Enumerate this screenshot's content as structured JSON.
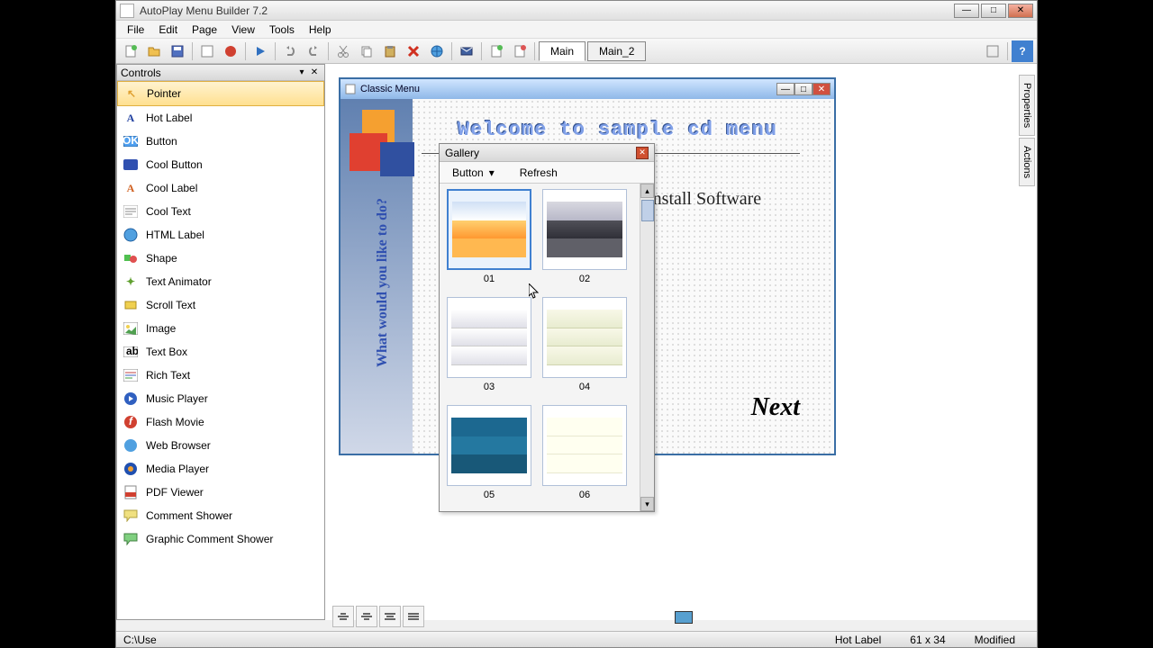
{
  "app": {
    "title": "AutoPlay Menu Builder 7.2"
  },
  "menus": [
    "File",
    "Edit",
    "Page",
    "View",
    "Tools",
    "Help"
  ],
  "tabs": {
    "active": "Main",
    "inactive": "Main_2"
  },
  "controls_panel": {
    "title": "Controls",
    "items": [
      "Pointer",
      "Hot Label",
      "Button",
      "Cool Button",
      "Cool Label",
      "Cool Text",
      "HTML Label",
      "Shape",
      "Text Animator",
      "Scroll Text",
      "Image",
      "Text Box",
      "Rich Text",
      "Music Player",
      "Flash Movie",
      "Web Browser",
      "Media Player",
      "PDF Viewer",
      "Comment Shower",
      "Graphic Comment Shower"
    ],
    "selected_index": 0
  },
  "canvas": {
    "window_title": "Classic Menu",
    "welcome": "Welcome to sample cd menu",
    "vertical_question": "What would you like to do?",
    "install_label": "Install Software",
    "next_label": "Next"
  },
  "gallery": {
    "title": "Gallery",
    "dropdown": "Button",
    "refresh": "Refresh",
    "labels": [
      "01",
      "02",
      "03",
      "04",
      "05",
      "06"
    ]
  },
  "right_tabs": [
    "Properties",
    "Actions"
  ],
  "statusbar": {
    "path": "C:\\Use",
    "element": "Hot Label",
    "size": "61 x 34",
    "state": "Modified"
  }
}
